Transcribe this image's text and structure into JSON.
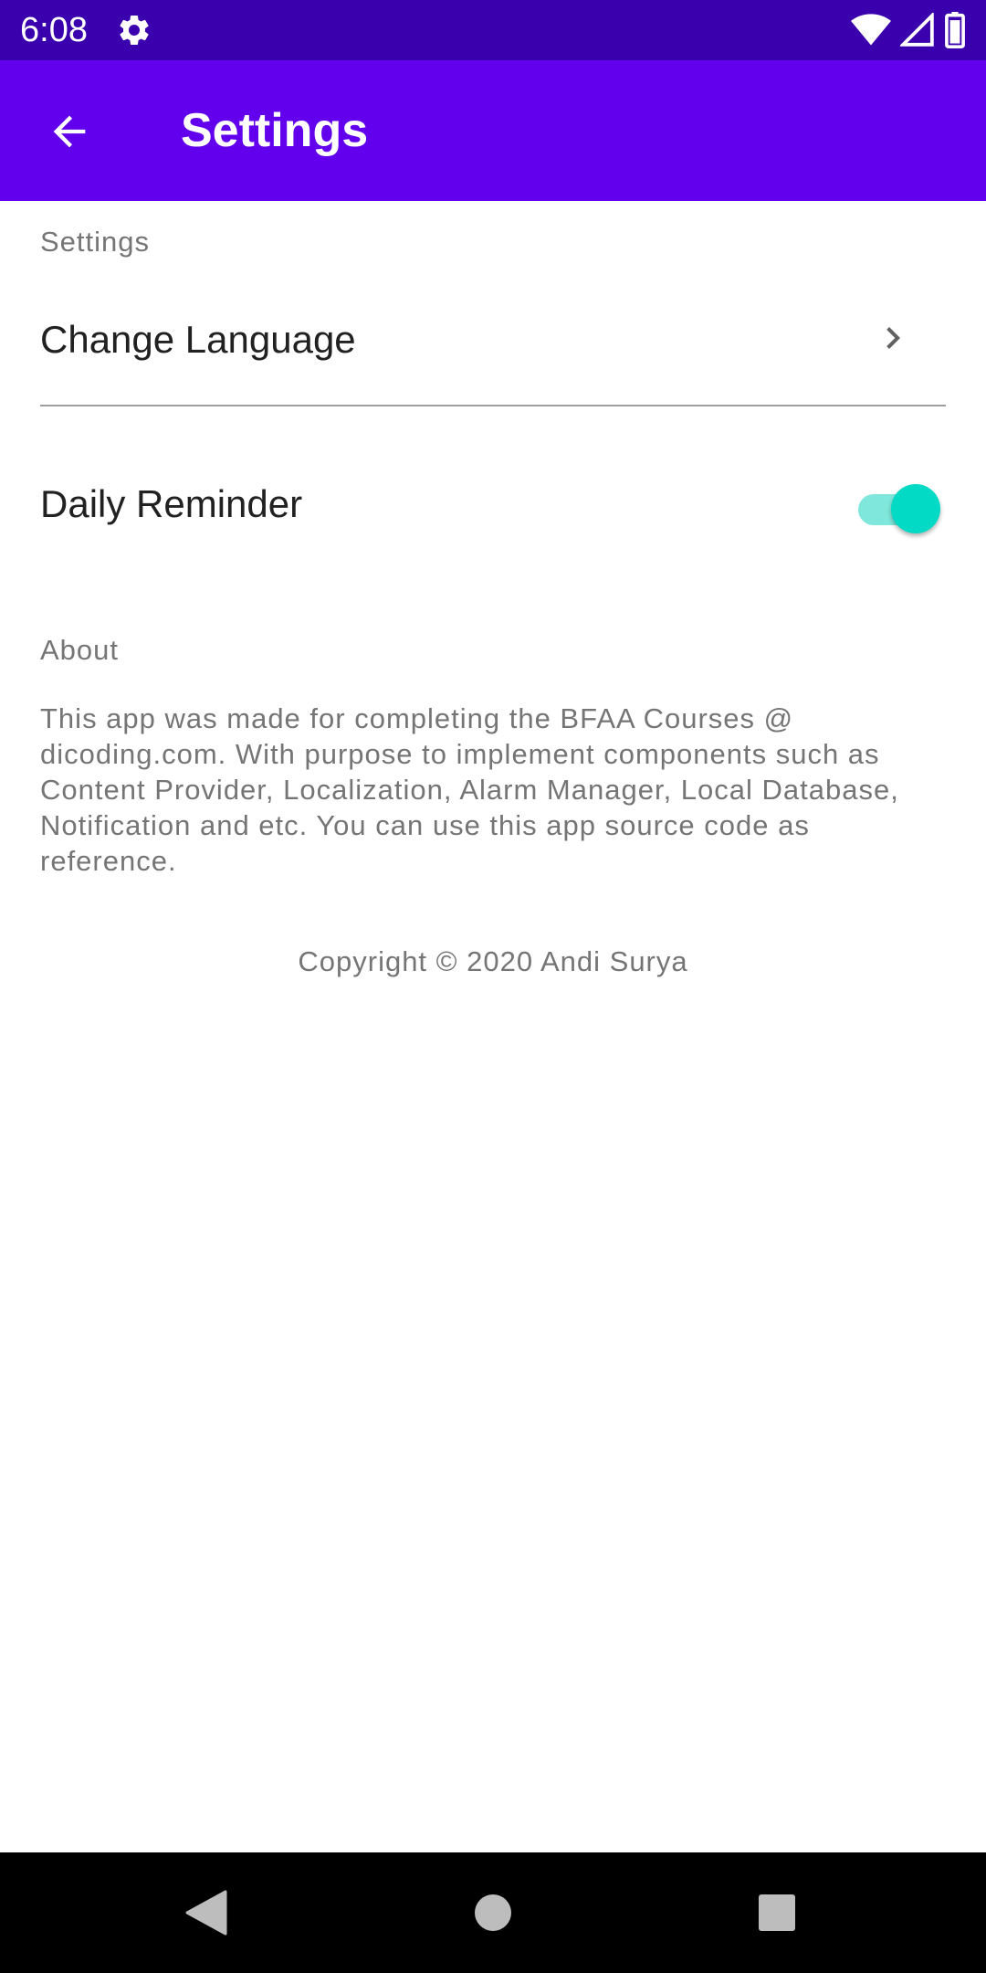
{
  "status_bar": {
    "time": "6:08",
    "left_icons": [
      "gear-icon"
    ],
    "right_icons": [
      "wifi-icon",
      "signal-icon",
      "battery-icon"
    ]
  },
  "app_bar": {
    "title": "Settings",
    "back_icon": "arrow-back-icon",
    "background_color": "#6200ee"
  },
  "settings_section": {
    "header": "Settings",
    "items": [
      {
        "label": "Change Language",
        "icon": "chevron-right-icon"
      },
      {
        "label": "Daily Reminder",
        "toggle_on": true
      }
    ]
  },
  "about_section": {
    "header": "About",
    "body": "This app was made for completing the BFAA Courses @ dicoding.com. With purpose to implement components such as Content Provider, Localization, Alarm Manager, Local Database, Notification and etc. You can use this app source code as reference.",
    "copyright": "Copyright © 2020 Andi Surya"
  },
  "nav_bar": {
    "buttons": [
      "back-triangle-icon",
      "home-circle-icon",
      "recents-square-icon"
    ]
  },
  "colors": {
    "status_bar": "#3a00ad",
    "accent": "#03dac5",
    "secondary_text": "#757575",
    "primary_text": "#212121"
  }
}
